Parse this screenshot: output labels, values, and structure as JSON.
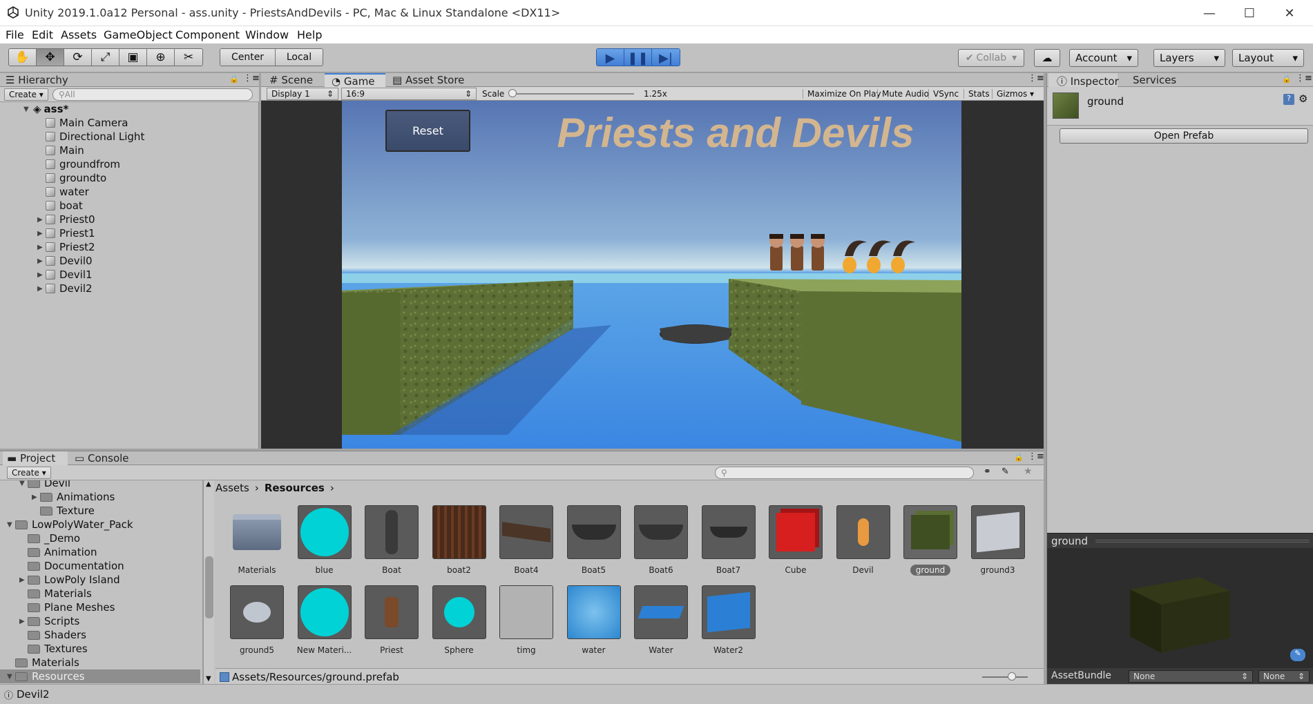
{
  "window": {
    "title": "Unity 2019.1.0a12 Personal - ass.unity - PriestsAndDevils - PC, Mac & Linux Standalone <DX11>",
    "minimize": "—",
    "maximize": "☐",
    "close": "✕"
  },
  "menu": [
    "File",
    "Edit",
    "Assets",
    "GameObject",
    "Component",
    "Window",
    "Help"
  ],
  "toolbar": {
    "center_label": "Center",
    "local_label": "Local",
    "collab_label": "Collab",
    "account_label": "Account",
    "layers_label": "Layers",
    "layout_label": "Layout"
  },
  "hierarchy": {
    "tab": "Hierarchy",
    "create": "Create",
    "search_placeholder": "All",
    "scene": "ass*",
    "items": [
      "Main Camera",
      "Directional Light",
      "Main",
      "groundfrom",
      "groundto",
      "water",
      "boat",
      "Priest0",
      "Priest1",
      "Priest2",
      "Devil0",
      "Devil1",
      "Devil2"
    ]
  },
  "game": {
    "tabs": [
      "Scene",
      "Game",
      "Asset Store"
    ],
    "display": "Display 1",
    "aspect": "16:9",
    "scale_label": "Scale",
    "scale_value": "1.25x",
    "options": [
      "Maximize On Play",
      "Mute Audio",
      "VSync",
      "Stats",
      "Gizmos"
    ],
    "reset_button": "Reset",
    "heading": "Priests and Devils"
  },
  "inspector": {
    "tabs": [
      "Inspector",
      "Services"
    ],
    "object_name": "ground",
    "open_prefab": "Open Prefab",
    "preview_title": "ground",
    "assetbundle_label": "AssetBundle",
    "assetbundle_value": "None",
    "assetbundle_variant": "None"
  },
  "project": {
    "tabs": [
      "Project",
      "Console"
    ],
    "create": "Create",
    "tree": [
      {
        "label": "Devil",
        "indent": 2,
        "arrow": "open",
        "folder": true
      },
      {
        "label": "Animations",
        "indent": 3,
        "arrow": "closed",
        "folder": true
      },
      {
        "label": "Texture",
        "indent": 3,
        "arrow": "",
        "folder": true
      },
      {
        "label": "LowPolyWater_Pack",
        "indent": 1,
        "arrow": "open",
        "folder": true
      },
      {
        "label": "_Demo",
        "indent": 2,
        "arrow": "",
        "folder": true
      },
      {
        "label": "Animation",
        "indent": 2,
        "arrow": "",
        "folder": true
      },
      {
        "label": "Documentation",
        "indent": 2,
        "arrow": "",
        "folder": true
      },
      {
        "label": "LowPoly Island",
        "indent": 2,
        "arrow": "closed",
        "folder": true
      },
      {
        "label": "Materials",
        "indent": 2,
        "arrow": "",
        "folder": true
      },
      {
        "label": "Plane Meshes",
        "indent": 2,
        "arrow": "",
        "folder": true
      },
      {
        "label": "Scripts",
        "indent": 2,
        "arrow": "closed",
        "folder": true
      },
      {
        "label": "Shaders",
        "indent": 2,
        "arrow": "",
        "folder": true
      },
      {
        "label": "Textures",
        "indent": 2,
        "arrow": "",
        "folder": true
      },
      {
        "label": "Materials",
        "indent": 1,
        "arrow": "",
        "folder": true
      },
      {
        "label": "Resources",
        "indent": 1,
        "arrow": "open",
        "folder": true
      }
    ],
    "breadcrumb": [
      "Assets",
      "Resources"
    ],
    "assets_row1": [
      "Materials",
      "blue",
      "Boat",
      "boat2",
      "Boat4",
      "Boat5",
      "Boat6",
      "Boat7",
      "Cube",
      "Devil",
      "ground",
      "ground3"
    ],
    "assets_row2": [
      "ground5",
      "New Materi...",
      "Priest",
      "Sphere",
      "timg",
      "water",
      "Water",
      "Water2"
    ],
    "selected_path": "Assets/Resources/ground.prefab"
  },
  "status": {
    "text": "Devil2"
  },
  "colors": {
    "cyan": "#00d2d6",
    "red": "#d71f1f",
    "title_tan": "#d3b68f",
    "sky_top": "#5675b3",
    "water": "#3e8fe4",
    "grass": "#5c6f35"
  }
}
